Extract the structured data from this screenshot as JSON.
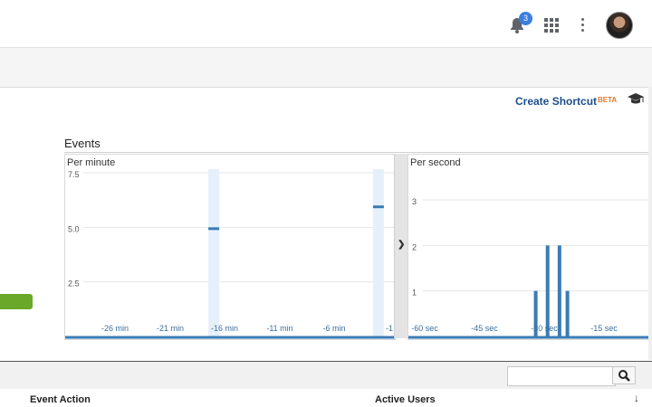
{
  "topbar": {
    "notification_count": "3"
  },
  "header": {
    "create_shortcut": "Create Shortcut",
    "beta": "BETA"
  },
  "events": {
    "title": "Events",
    "per_minute": "Per minute",
    "per_second": "Per second"
  },
  "table": {
    "col_event_action": "Event Action",
    "col_active_users": "Active Users"
  },
  "chart_data": [
    {
      "type": "bar",
      "title": "Per minute",
      "y_ticks": [
        "7.5",
        "5.0",
        "2.5"
      ],
      "x_ticks": [
        "-26 min",
        "-21 min",
        "-16 min",
        "-11 min",
        "-6 min",
        "-1"
      ],
      "ylim": [
        0,
        7.5
      ],
      "bars": [
        {
          "x": -17,
          "value": 5
        },
        {
          "x": -2,
          "value": 6
        }
      ],
      "grid": true
    },
    {
      "type": "bar",
      "title": "Per second",
      "y_ticks": [
        "3",
        "2",
        "1"
      ],
      "x_ticks": [
        "-60 sec",
        "-45 sec",
        "-30 sec",
        "-15 sec"
      ],
      "ylim": [
        0,
        3
      ],
      "bars": [
        {
          "x": -32,
          "value": 1
        },
        {
          "x": -29,
          "value": 2
        },
        {
          "x": -26,
          "value": 2
        },
        {
          "x": -24,
          "value": 1
        }
      ],
      "grid": true
    }
  ],
  "colors": {
    "accent": "#1c4e8a",
    "bar": "#3a7bb5",
    "bar_bg": "#e6f0fa",
    "beta": "#e2792d",
    "button_green": "#6aa829"
  }
}
